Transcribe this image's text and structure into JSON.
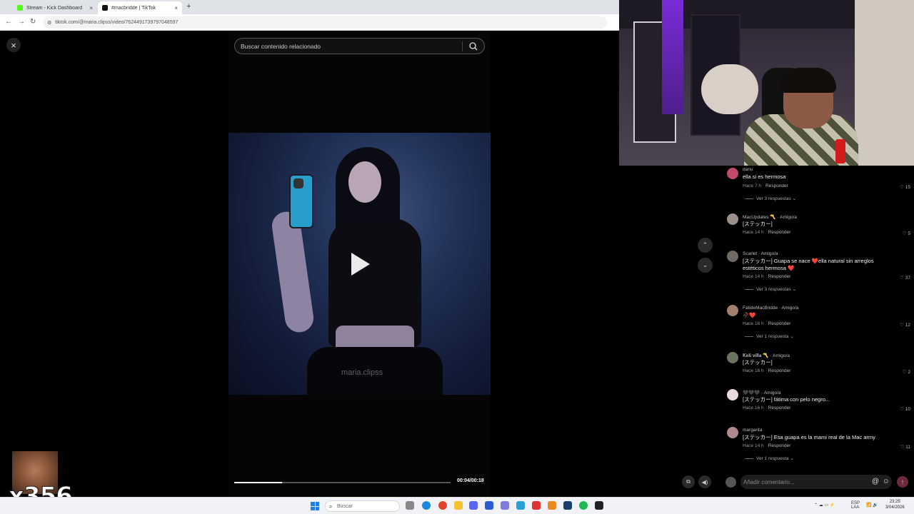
{
  "browser": {
    "tabs": [
      {
        "label": "Stream - Kick Dashboard",
        "favicon_color": "#53fc18",
        "active": false
      },
      {
        "label": "#macbridde | TikTok",
        "favicon_color": "#111111",
        "active": true
      }
    ],
    "new_tab": "+",
    "url": "tiktok.com/@maria.clipss/video/7624491739797048597"
  },
  "player": {
    "close_icon": "×",
    "search_placeholder": "Buscar contenido relacionado",
    "watermark": "maria.clipss",
    "time": "00:04/00:18",
    "progress_fraction": 0.22
  },
  "comments": [
    {
      "name": "danu",
      "text": "ella si es hermosa",
      "time": "Hace 7 h",
      "reply": "Responder",
      "likes": "15",
      "replies": "Ver 3 respuestas",
      "avatar_color": "#c24a6b"
    },
    {
      "name": "MacUpdates 〽️ · Amigo/a",
      "text": "[ステッカー]",
      "time": "Hace 14 h",
      "reply": "Responder",
      "likes": "5",
      "replies": "",
      "avatar_color": "#9a8f8a"
    },
    {
      "name": "Scarlet · Amigo/a",
      "text": "[ステッカー] Guapa se nace ❤️ella natural sin arreglos estéticos hermosa ❤️",
      "time": "Hace 14 h",
      "reply": "Responder",
      "likes": "37",
      "replies": "Ver 3 respuestas",
      "avatar_color": "#6f6a64"
    },
    {
      "name": "FatideMacBridde · Amigo/a",
      "text": "🥀❤️",
      "time": "Hace 16 h",
      "reply": "Responder",
      "likes": "12",
      "replies": "Ver 1 respuesta",
      "avatar_color": "#a07f6f"
    },
    {
      "name": "𝐊𝐞𝐥𝐢 𝐯𝐢𝐥𝐥𝐚 〽️ · Amigo/a",
      "text": "[ステッカー]",
      "time": "Hace 16 h",
      "reply": "Responder",
      "likes": "2",
      "replies": "",
      "avatar_color": "#6a7560"
    },
    {
      "name": "🖤🖤🖤 · Amigo/a",
      "text": "[ステッカー] fátima con pelo negro...",
      "time": "Hace 16 h",
      "reply": "Responder",
      "likes": "10",
      "replies": "",
      "avatar_color": "#e8d9e2"
    },
    {
      "name": "margarita",
      "text": "[ステッカー] Esa guapa es la mami real de la Mac army",
      "time": "Hace 14 h",
      "reply": "Responder",
      "likes": "11",
      "replies": "Ver 1 respuesta",
      "avatar_color": "#b08a8f"
    }
  ],
  "comment_input": {
    "placeholder": "Añadir comentario...",
    "at_icon": "@",
    "emoji_icon": "☺",
    "send_icon": "↑"
  },
  "overlay": {
    "emote_count": "x356"
  },
  "taskbar": {
    "search_placeholder": "Buscar",
    "lang": "ESP\nLAA",
    "time": "23:25",
    "date": "3/04/2026"
  }
}
